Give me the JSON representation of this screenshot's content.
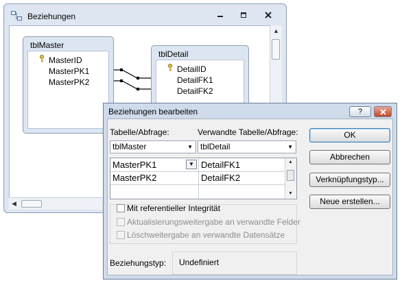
{
  "background_window": {
    "title": "Beziehungen",
    "icon": "relationships-icon",
    "controls": {
      "minimize": "minimize-icon",
      "restore": "restore-icon",
      "close": "close-icon"
    }
  },
  "tables": {
    "master": {
      "name": "tblMaster",
      "fields": [
        "MasterID",
        "MasterPK1",
        "MasterPK2"
      ]
    },
    "detail": {
      "name": "tblDetail",
      "fields": [
        "DetailID",
        "DetailFK1",
        "DetailFK2"
      ]
    }
  },
  "dialog": {
    "title": "Beziehungen bearbeiten",
    "help_label": "?",
    "close_label": "X",
    "table_label": "Tabelle/Abfrage:",
    "related_label": "Verwandte Tabelle/Abfrage:",
    "table_value": "tblMaster",
    "related_value": "tblDetail",
    "grid_rows": [
      {
        "left": "MasterPK1",
        "right": "DetailFK1"
      },
      {
        "left": "MasterPK2",
        "right": "DetailFK2"
      }
    ],
    "buttons": {
      "ok": "OK",
      "cancel": "Abbrechen",
      "join_type": "Verknüpfungstyp...",
      "create_new": "Neue erstellen..."
    },
    "integrity_label": "Mit referentieller Integrität",
    "cascade_update_label": "Aktualisierungsweitergabe an verwandte Felder",
    "cascade_delete_label": "Löschweitergabe an verwandte Datensätze",
    "relationship_type_label": "Beziehungstyp:",
    "relationship_type_value": "Undefiniert"
  }
}
